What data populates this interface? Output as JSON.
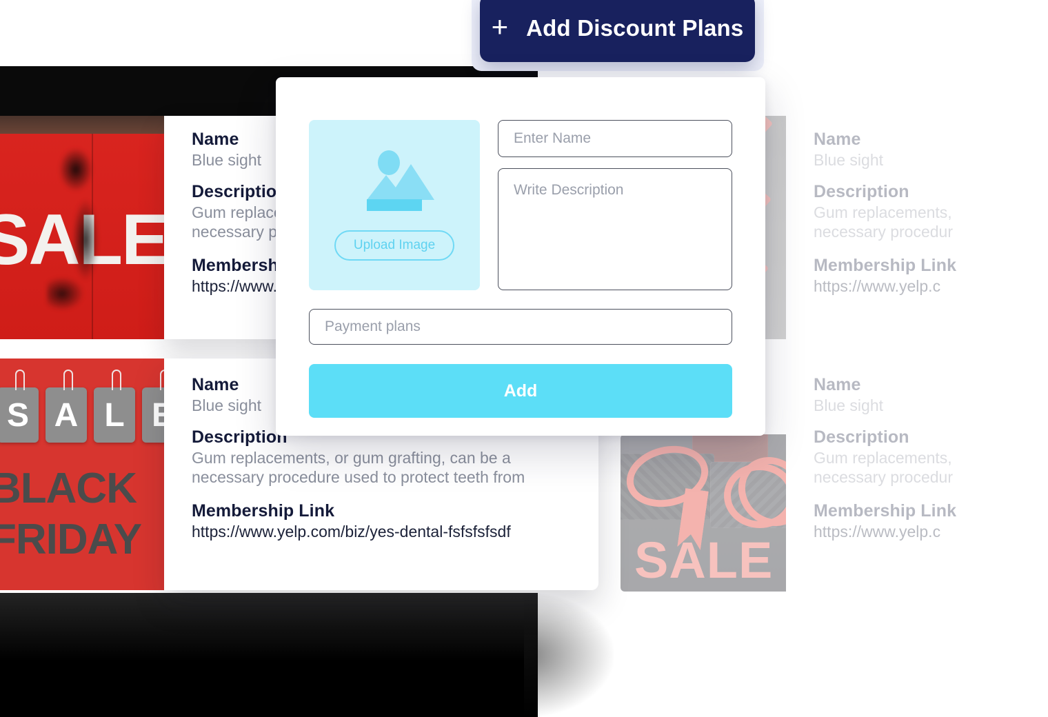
{
  "header": {
    "add_discount_plans_label": "Add Discount Plans",
    "plus_icon": "plus-icon",
    "navy_color": "#18215e"
  },
  "modal": {
    "upload": {
      "placeholder_icon": "image-placeholder-icon",
      "upload_button_label": "Upload Image",
      "panel_color": "#cdf3fb",
      "accent_color": "#5fd2f0"
    },
    "fields": {
      "name_placeholder": "Enter Name",
      "name_value": "",
      "description_placeholder": "Write Description",
      "description_value": "",
      "payment_plans_placeholder": "Payment plans",
      "payment_plans_value": ""
    },
    "submit_label": "Add",
    "submit_color": "#5cdef7"
  },
  "cards": [
    {
      "image": "red-sale-poster-image",
      "name_label": "Name",
      "name_value": "Blue sight",
      "description_label": "Description",
      "description_line1": "Gum replacements, or gum grafting, can be a",
      "description_line2": "necessary procedure used to protect teeth from",
      "link_label": "Membership Link",
      "link_value": "https://www.yelp.com/biz/yes-dental-fsfsfsfsdf"
    },
    {
      "image": "black-friday-sale-tags-image",
      "name_label": "Name",
      "name_value": "Blue sight",
      "description_label": "Description",
      "description_line1": "Gum replacements, or gum grafting, can be a",
      "description_line2": "necessary procedure used to protect teeth from",
      "link_label": "Membership Link",
      "link_value": "https://www.yelp.com/biz/yes-dental-fsfsfsfsdf"
    },
    {
      "image": "grey-sale-tags-image",
      "name_label": "Name",
      "name_value": "Blue sight",
      "description_label": "Description",
      "description_line1": "Gum replacements,",
      "description_line2": "necessary procedur",
      "link_label": "Membership Link",
      "link_value": "https://www.yelp.c"
    },
    {
      "image": "gift-boxes-sale-image",
      "name_label": "Name",
      "name_value": "Blue sight",
      "description_label": "Description",
      "description_line1": "Gum replacements,",
      "description_line2": "necessary procedur",
      "link_label": "Membership Link",
      "link_value": "https://www.yelp.c"
    }
  ],
  "decorative": {
    "sale_word": "SALE",
    "black_word": "BLACK",
    "friday_word": "FRIDAY",
    "tag_letters": [
      "S",
      "A",
      "L",
      "E"
    ]
  }
}
